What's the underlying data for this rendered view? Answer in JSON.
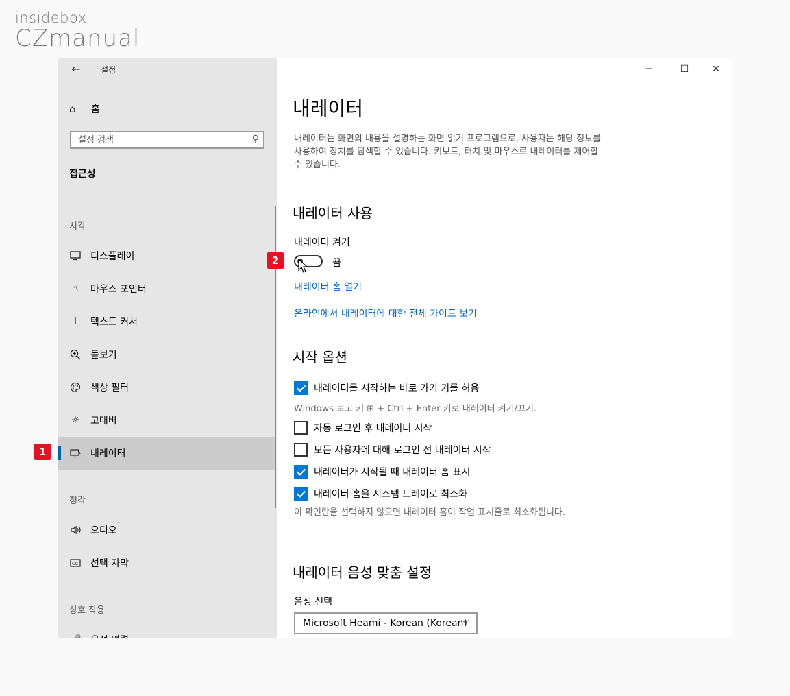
{
  "watermark": {
    "top": "insidebox",
    "bottom": "CZmanual"
  },
  "window": {
    "title": "설정",
    "back_icon": "back-arrow-icon",
    "controls": {
      "minimize": "─",
      "maximize": "☐",
      "close": "✕"
    }
  },
  "sidebar": {
    "home_label": "홈",
    "search_placeholder": "설정 검색",
    "section_title": "접근성",
    "groups": [
      {
        "label": "시각"
      },
      {
        "label": "청각"
      },
      {
        "label": "상호 작용"
      }
    ],
    "items": [
      {
        "label": "디스플레이",
        "icon": "display-icon"
      },
      {
        "label": "마우스 포인터",
        "icon": "mouse-pointer-icon"
      },
      {
        "label": "텍스트 커서",
        "icon": "text-cursor-icon"
      },
      {
        "label": "돋보기",
        "icon": "magnifier-icon"
      },
      {
        "label": "색상 필터",
        "icon": "color-filter-icon"
      },
      {
        "label": "고대비",
        "icon": "high-contrast-icon"
      },
      {
        "label": "내레이터",
        "icon": "narrator-icon",
        "active": true
      },
      {
        "label": "오디오",
        "icon": "audio-icon"
      },
      {
        "label": "선택 자막",
        "icon": "closed-caption-icon"
      },
      {
        "label": "음성 명령",
        "icon": "speech-icon"
      }
    ]
  },
  "badges": {
    "one": "1",
    "two": "2"
  },
  "content": {
    "title": "내레이터",
    "description": "내레이터는 화면의 내용을 설명하는 화면 읽기 프로그램으로, 사용자는 해당 정보를 사용하여 장치를 탐색할 수 있습니다. 키보드, 터치 및 마우스로 내레이터를 제어할 수 있습니다.",
    "use_heading": "내레이터 사용",
    "toggle_label": "내레이터 켜기",
    "toggle_state": "끔",
    "toggle_on": false,
    "link_home": "내레이터 홈 열기",
    "link_guide": "온라인에서 내레이터에 대한 전체 가이드 보기",
    "start_heading": "시작 옵션",
    "options": [
      {
        "label": "내레이터를 시작하는 바로 가기 키를 허용",
        "checked": true
      },
      {
        "label": "자동 로그인 후 내레이터 시작",
        "checked": false
      },
      {
        "label": "모든 사용자에 대해 로그인 전 내레이터 시작",
        "checked": false
      },
      {
        "label": "내레이터가 시작될 때 내레이터 홈 표시",
        "checked": true
      },
      {
        "label": "내레이터 홈을 시스템 트레이로 최소화",
        "checked": true
      }
    ],
    "shortcut_note": "Windows 로고 키 ⊞ + Ctrl + Enter 키로 내레이터 켜기/끄기.",
    "minimize_note": "이 확인란을 선택하지 않으면 내레이터 홈이 작업 표시줄로 최소화됩니다.",
    "voice_heading": "내레이터 음성 맞춤 설정",
    "voice_label": "음성 선택",
    "voice_value": "Microsoft Heami - Korean (Korean)"
  }
}
